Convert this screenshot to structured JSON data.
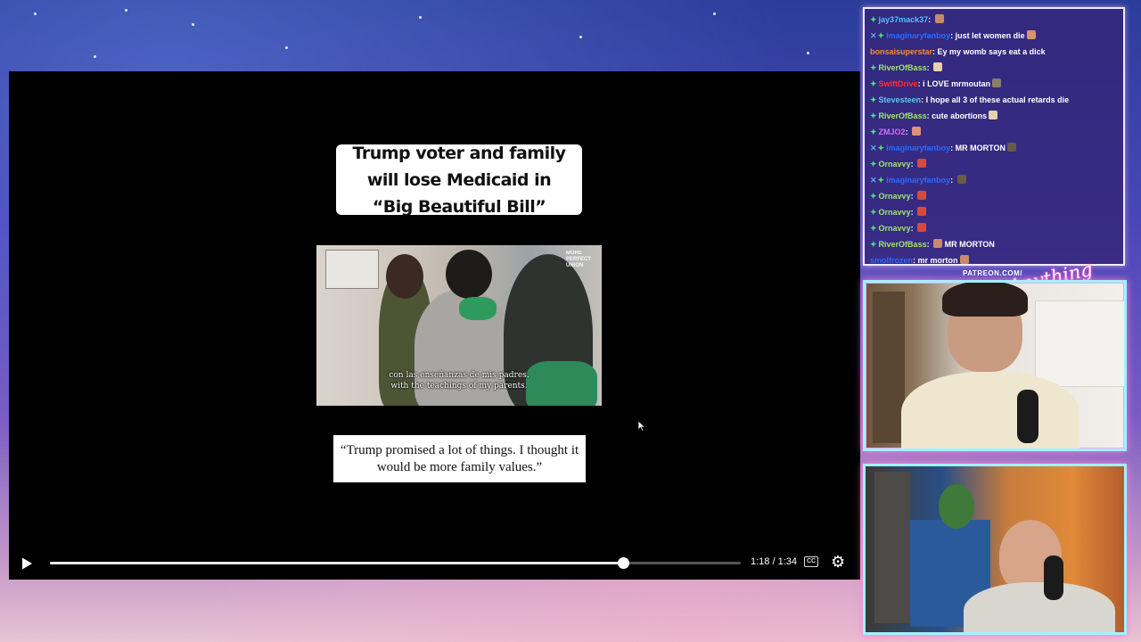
{
  "video": {
    "title_card": "Trump voter and family will lose Medicaid in “Big Beautiful Bill”",
    "watermark": "MORE\nPERFECT\nUNION",
    "subtitle_es": "con las enseñanzas de mis padres.",
    "subtitle_en": "with the teachings of my parents.",
    "quote": "“Trump promised a lot of things. I thought it would be more family values.”",
    "time_display": "1:18 / 1:34",
    "progress_fraction": 0.83,
    "cc_label": "CC"
  },
  "chat": {
    "messages": [
      {
        "user": "jay37mack37",
        "color": "#4fc3ff",
        "badges": [
          "green"
        ],
        "text": "",
        "emote": "#c98a6a"
      },
      {
        "user": "imaginaryfanboy",
        "color": "#2c6bff",
        "badges": [
          "x",
          "green"
        ],
        "text": "just let women die",
        "emote": "#d9956a"
      },
      {
        "user": "bonsaisuperstar",
        "color": "#ff8a2b",
        "badges": [],
        "text": "Ey my womb says eat a dick",
        "emote": ""
      },
      {
        "user": "RiverOfBass",
        "color": "#9be86a",
        "badges": [
          "green"
        ],
        "text": "",
        "emote": "#e6d3a8"
      },
      {
        "user": "SwiftDrive",
        "color": "#ff3030",
        "badges": [
          "green"
        ],
        "text": "i LOVE mrmoutan",
        "emote": "#8a7d6a"
      },
      {
        "user": "Stevesteen",
        "color": "#5ec8e6",
        "badges": [
          "green"
        ],
        "text": "I hope all 3 of these actual retards die",
        "emote": ""
      },
      {
        "user": "RiverOfBass",
        "color": "#9be86a",
        "badges": [
          "green"
        ],
        "text": "cute abortions",
        "emote": "#e6d3a8"
      },
      {
        "user": "ZMJO2",
        "color": "#d86bff",
        "badges": [
          "green"
        ],
        "text": "",
        "emote": "#e0917a"
      },
      {
        "user": "imaginaryfanboy",
        "color": "#2c6bff",
        "badges": [
          "x",
          "green"
        ],
        "text": "MR MORTON",
        "emote": "#6a5a4a"
      },
      {
        "user": "Ornavvy",
        "color": "#9be86a",
        "badges": [
          "green"
        ],
        "text": "",
        "emote": "#d84a3a"
      },
      {
        "user": "imaginaryfanboy",
        "color": "#2c6bff",
        "badges": [
          "x",
          "green"
        ],
        "text": "",
        "emote": "#6a5a4a"
      },
      {
        "user": "Ornavvy",
        "color": "#9be86a",
        "badges": [
          "green"
        ],
        "text": "",
        "emote": "#d84a3a"
      },
      {
        "user": "Ornavvy",
        "color": "#9be86a",
        "badges": [
          "green"
        ],
        "text": "",
        "emote": "#d84a3a"
      },
      {
        "user": "Ornavvy",
        "color": "#9be86a",
        "badges": [
          "green"
        ],
        "text": "",
        "emote": "#d84a3a"
      },
      {
        "user": "RiverOfBass",
        "color": "#9be86a",
        "badges": [
          "green"
        ],
        "text": "MR MORTON",
        "emote": "#c98a6a",
        "emote_first": true
      },
      {
        "user": "smolfrozen",
        "color": "#2c6bff",
        "badges": [],
        "text": "mr morton",
        "emote": "#c98a6a"
      }
    ]
  },
  "overlay": {
    "patreon_text": "PATREON.COM/",
    "logo_text": "Anything Else?"
  }
}
